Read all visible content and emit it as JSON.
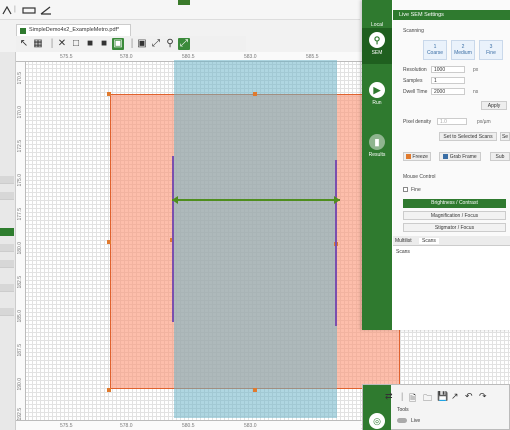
{
  "document": {
    "tab_title": "SimpleDemo4x2_ExampleMetro.pdf*"
  },
  "ruler": {
    "top_ticks": [
      "575.5",
      "578.0",
      "580.5",
      "583.0",
      "585.5"
    ],
    "left_ticks": [
      "170.5",
      "170.0",
      "172.5",
      "175.0",
      "177.5",
      "180.0",
      "182.5",
      "185.0",
      "187.5",
      "190.0",
      "192.5"
    ],
    "bottom_ticks": [
      "575.5",
      "578.0",
      "580.5",
      "583.0"
    ]
  },
  "sidebar": {
    "items": [
      {
        "label": "Local",
        "icon": "cube-icon"
      },
      {
        "label": "SEM",
        "icon": "microscope-icon"
      },
      {
        "label": "Run",
        "icon": "play-icon"
      },
      {
        "label": "Results",
        "icon": "chart-icon"
      }
    ]
  },
  "sem_panel": {
    "header": "Live SEM Settings",
    "scanning_label": "Scanning",
    "scan_modes": [
      {
        "num": "1",
        "label": "Coarse"
      },
      {
        "num": "2",
        "label": "Medium"
      },
      {
        "num": "3",
        "label": "Fine"
      }
    ],
    "resolution_label": "Resolution",
    "resolution_value": "1000",
    "resolution_unit": "px",
    "samples_label": "Samples",
    "samples_value": "1",
    "dwell_label": "Dwell Time",
    "dwell_value": "2000",
    "dwell_unit": "ns",
    "apply_label": "Apply",
    "pixel_density_label": "Pixel density",
    "pixel_density_value": "1.0",
    "pixel_density_unit": "px/µm",
    "set_selected_scans_label": "Set to Selected Scans",
    "set_short_label": "Se",
    "freeze_label": "Freeze",
    "grab_frame_label": "Grab Frame",
    "sub_label": "Sub",
    "mouse_control_label": "Mouse Control",
    "fine_label": "Fine",
    "brightness_contrast_label": "Brightness / Contrast",
    "magnification_focus_label": "Magnification / Focus",
    "stigmator_focus_label": "Stigmator / Focus"
  },
  "lower_tabs": {
    "multilist": "Multilist",
    "scans": "Scans",
    "scans_header": "Scans"
  },
  "tool_window": {
    "tools_label": "Tools",
    "live_label": "Live"
  }
}
